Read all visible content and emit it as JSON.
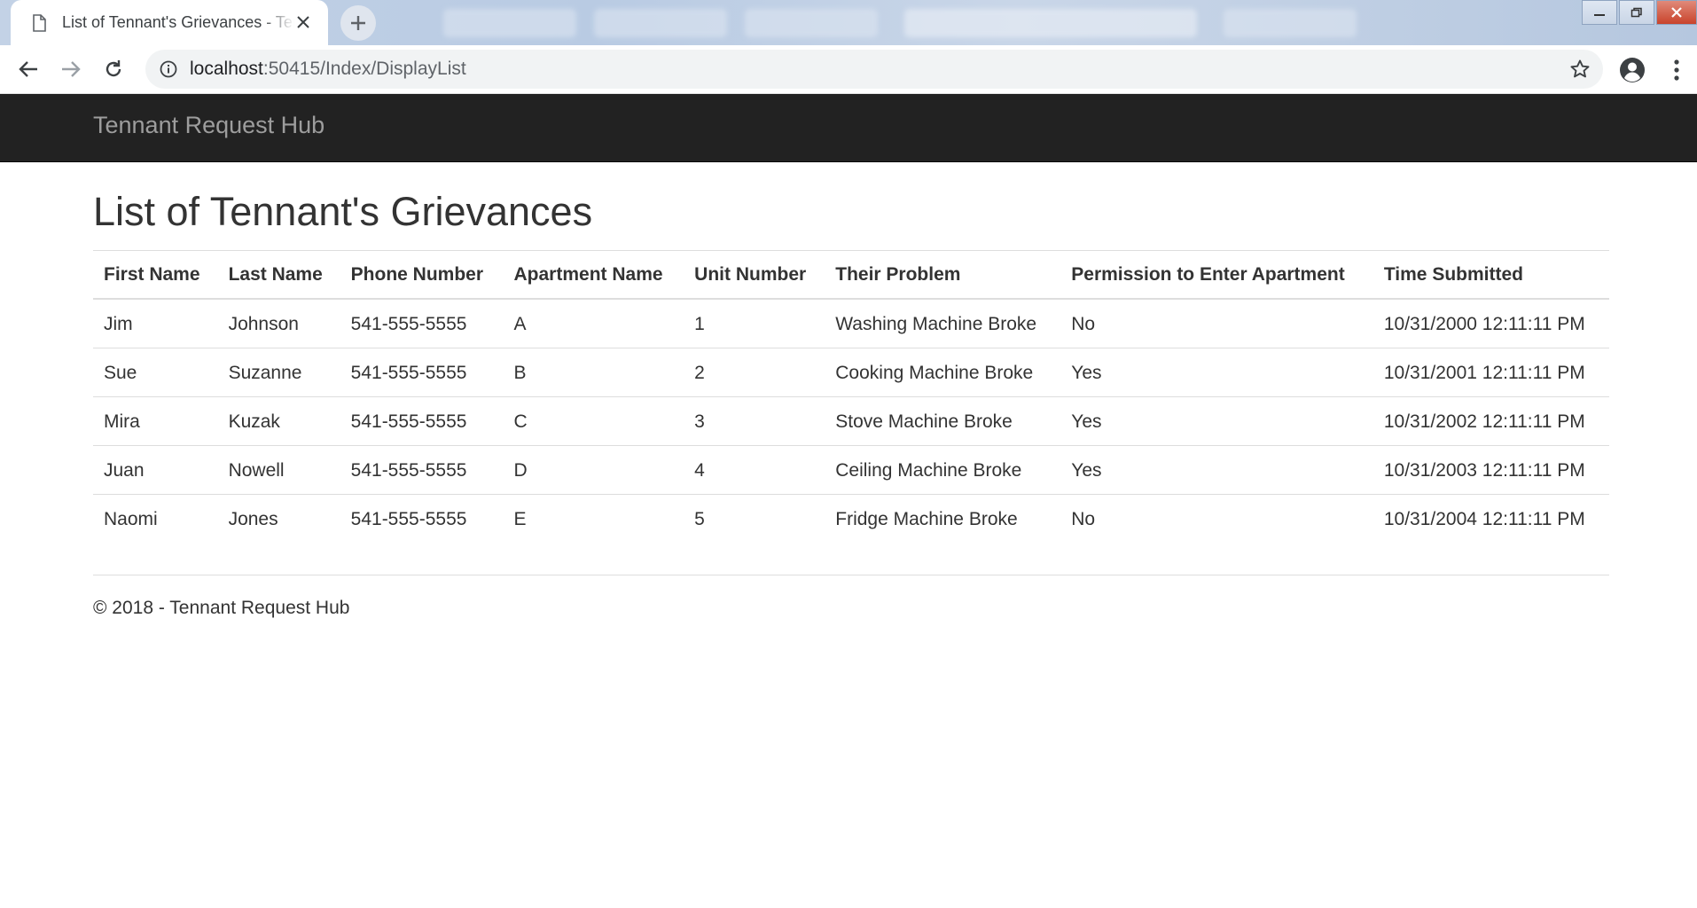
{
  "browser": {
    "tab_title": "List of Tennant's Grievances - Tennant Request Hub",
    "url_host": "localhost",
    "url_rest": ":50415/Index/DisplayList"
  },
  "navbar": {
    "brand": "Tennant Request Hub"
  },
  "main": {
    "title": "List of Tennant's Grievances",
    "columns": [
      "First Name",
      "Last Name",
      "Phone Number",
      "Apartment Name",
      "Unit Number",
      "Their Problem",
      "Permission to Enter Apartment",
      "Time Submitted"
    ],
    "rows": [
      [
        "Jim",
        "Johnson",
        "541-555-5555",
        "A",
        "1",
        "Washing Machine Broke",
        "No",
        "10/31/2000 12:11:11 PM"
      ],
      [
        "Sue",
        "Suzanne",
        "541-555-5555",
        "B",
        "2",
        "Cooking Machine Broke",
        "Yes",
        "10/31/2001 12:11:11 PM"
      ],
      [
        "Mira",
        "Kuzak",
        "541-555-5555",
        "C",
        "3",
        "Stove Machine Broke",
        "Yes",
        "10/31/2002 12:11:11 PM"
      ],
      [
        "Juan",
        "Nowell",
        "541-555-5555",
        "D",
        "4",
        "Ceiling Machine Broke",
        "Yes",
        "10/31/2003 12:11:11 PM"
      ],
      [
        "Naomi",
        "Jones",
        "541-555-5555",
        "E",
        "5",
        "Fridge Machine Broke",
        "No",
        "10/31/2004 12:11:11 PM"
      ]
    ]
  },
  "footer": {
    "text": "© 2018 - Tennant Request Hub"
  },
  "colors": {
    "navbar_bg": "#222222",
    "brand_text": "#9d9d9d",
    "border": "#dddddd"
  }
}
